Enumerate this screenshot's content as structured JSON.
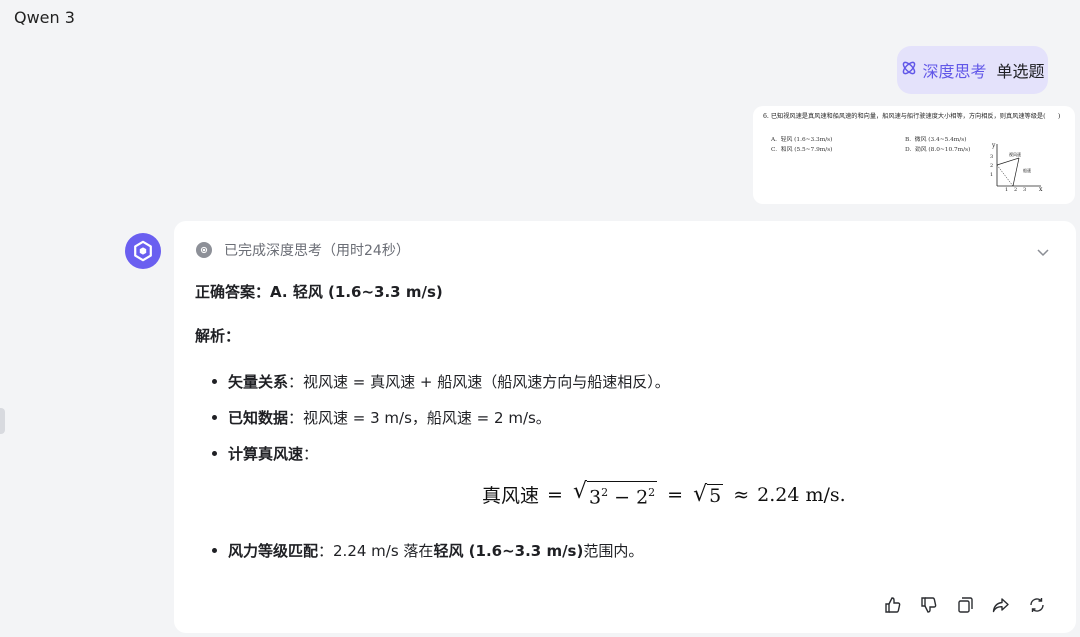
{
  "app": {
    "title": "Qwen 3"
  },
  "user_message": {
    "mode_tag": "深度思考",
    "text": "单选题"
  },
  "attachment": {
    "question": "6. 已知视风速是真风速和船风速的和向量，船风速与船行驶速度大小相等，方向相反，则真风速等级是(　　)",
    "options": [
      {
        "key": "A.",
        "text": "轻风 (1.6~3.3m/s)"
      },
      {
        "key": "B.",
        "text": "微风 (3.4~5.4m/s)"
      },
      {
        "key": "C.",
        "text": "和风 (5.5~7.9m/s)"
      },
      {
        "key": "D.",
        "text": "劲风 (8.0~10.7m/s)"
      }
    ],
    "graph": {
      "y_label": "y",
      "x_label": "x",
      "y_ticks": [
        "3",
        "2",
        "1"
      ],
      "x_ticks": [
        "1",
        "2",
        "3"
      ],
      "label_view": "视风速",
      "label_ship": "船速"
    }
  },
  "response": {
    "think_status": "已完成深度思考（用时24秒）",
    "answer_label": "正确答案：",
    "answer_value": "A. 轻风 (1.6~3.3 m/s)",
    "analysis_label": "解析：",
    "bullets": [
      {
        "bold": "矢量关系",
        "text": "：视风速 = 真风速 + 船风速（船风速方向与船速相反）。"
      },
      {
        "bold": "已知数据",
        "text": "：视风速 = 3 m/s，船风速 = 2 m/s。"
      },
      {
        "bold": "计算真风速",
        "text": "："
      }
    ],
    "formula": {
      "lhs": "真风速",
      "eq": "=",
      "radicand_a": "3",
      "exp": "2",
      "minus": "−",
      "radicand_b": "2",
      "eq2": "=",
      "sqrt5": "5",
      "approx": "≈",
      "result": "2.24 m/s."
    },
    "final_bullet": {
      "bold": "风力等级匹配",
      "pre": "：2.24 m/s 落在 ",
      "bold2": "轻风 (1.6~3.3 m/s)",
      "post": " 范围内。"
    }
  },
  "colors": {
    "accent": "#6157e8",
    "bubble": "#e4e2fb",
    "background": "#f3f4f6"
  }
}
